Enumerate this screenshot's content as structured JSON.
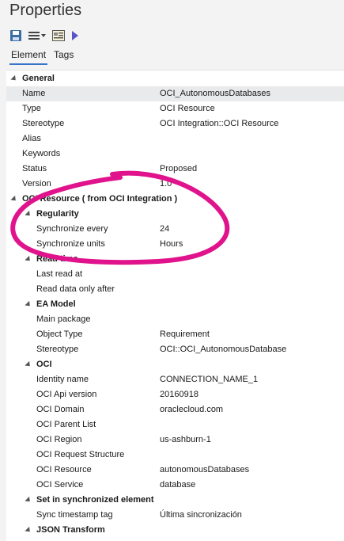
{
  "panel": {
    "title": "Properties"
  },
  "tabs": [
    {
      "label": "Element"
    },
    {
      "label": "Tags"
    }
  ],
  "toolbar": {
    "icons": [
      "save-icon",
      "menu-list-icon",
      "dropdown-icon",
      "properties-card-icon",
      "play-icon"
    ]
  },
  "sections": {
    "general": "General",
    "oci_resource": "OCI Resource  ( from OCI Integration )",
    "regularity": "Regularity",
    "read_time": "Read time",
    "ea_model": "EA Model",
    "oci": "OCI",
    "set_sync": "Set in synchronized element",
    "json_transform": "JSON Transform"
  },
  "general": {
    "name": {
      "key": "Name",
      "value": "OCI_AutonomousDatabases"
    },
    "type": {
      "key": "Type",
      "value": "OCI Resource"
    },
    "stereotype": {
      "key": "Stereotype",
      "value": "OCI Integration::OCI Resource"
    },
    "alias": {
      "key": "Alias",
      "value": ""
    },
    "keywords": {
      "key": "Keywords",
      "value": ""
    },
    "status": {
      "key": "Status",
      "value": "Proposed"
    },
    "version": {
      "key": "Version",
      "value": "1.0"
    }
  },
  "regularity": {
    "sync_every": {
      "key": "Synchronize every",
      "value": "24"
    },
    "sync_units": {
      "key": "Synchronize units",
      "value": "Hours"
    }
  },
  "read_time": {
    "last_read": {
      "key": "Last read at",
      "value": ""
    },
    "read_after": {
      "key": "Read data only after",
      "value": ""
    }
  },
  "ea_model": {
    "main_package": {
      "key": "Main package",
      "value": ""
    },
    "object_type": {
      "key": "Object Type",
      "value": "Requirement"
    },
    "stereotype": {
      "key": "Stereotype",
      "value": "OCI::OCI_AutonomousDatabase"
    }
  },
  "oci": {
    "identity": {
      "key": "Identity name",
      "value": "CONNECTION_NAME_1"
    },
    "api_version": {
      "key": "OCI Api version",
      "value": "20160918"
    },
    "domain": {
      "key": "OCI Domain",
      "value": "oraclecloud.com"
    },
    "parent_list": {
      "key": "OCI Parent List",
      "value": ""
    },
    "region": {
      "key": "OCI Region",
      "value": "us-ashburn-1"
    },
    "request_structure": {
      "key": "OCI Request Structure",
      "value": ""
    },
    "resource": {
      "key": "OCI Resource",
      "value": "autonomousDatabases"
    },
    "service": {
      "key": "OCI Service",
      "value": "database"
    }
  },
  "set_sync": {
    "sync_tag": {
      "key": "Sync timestamp tag",
      "value": "Última sincronización"
    }
  },
  "colors": {
    "annotation": "#e0138c",
    "active_tab": "#3a74c9",
    "save_icon": "#3b6ea5",
    "play_icon": "#5b55c9"
  }
}
